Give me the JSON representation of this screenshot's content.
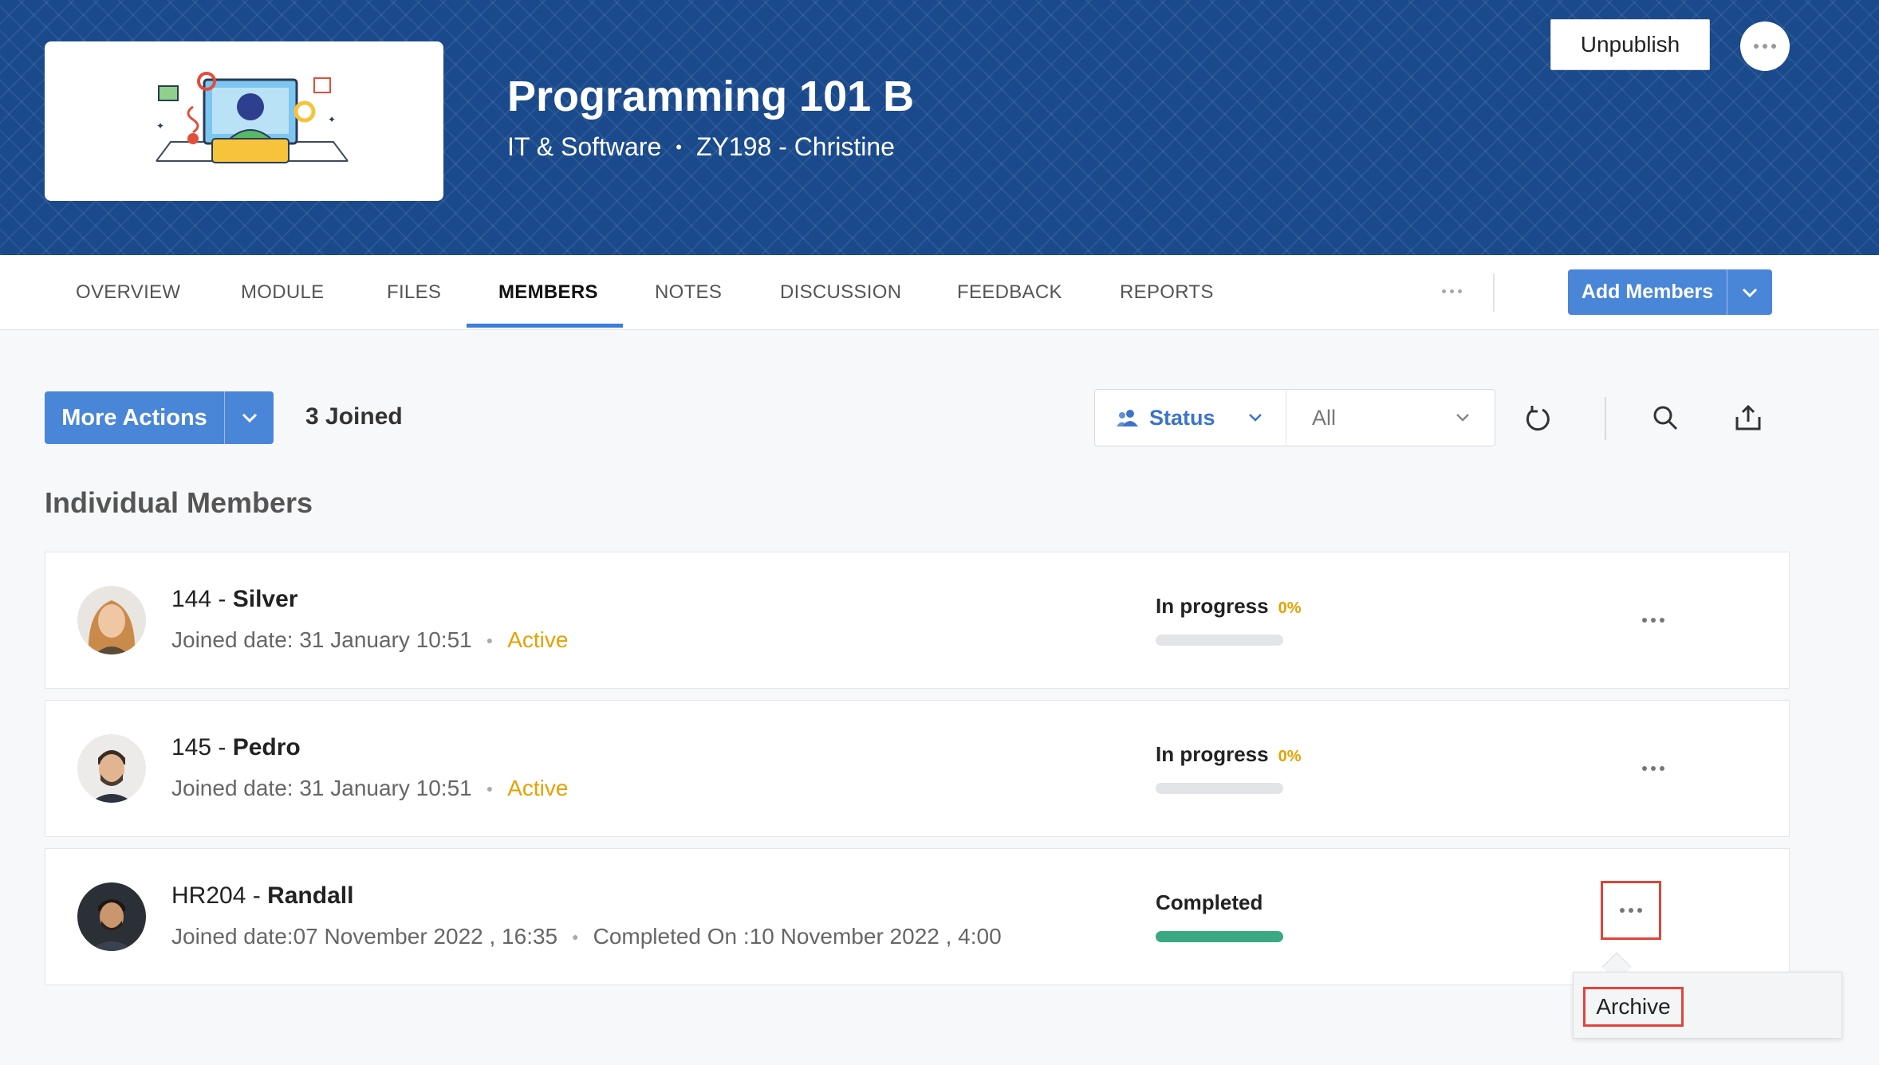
{
  "course": {
    "title": "Programming 101 B",
    "category": "IT & Software",
    "code_owner": "ZY198 - Christine"
  },
  "header": {
    "unpublish_label": "Unpublish"
  },
  "tabs": [
    {
      "label": "OVERVIEW",
      "active": false
    },
    {
      "label": "MODULE",
      "active": false
    },
    {
      "label": "FILES",
      "active": false
    },
    {
      "label": "MEMBERS",
      "active": true
    },
    {
      "label": "NOTES",
      "active": false
    },
    {
      "label": "DISCUSSION",
      "active": false
    },
    {
      "label": "FEEDBACK",
      "active": false
    },
    {
      "label": "REPORTS",
      "active": false
    }
  ],
  "add_members_label": "Add Members",
  "toolbar": {
    "more_actions_label": "More Actions",
    "joined_count": "3 Joined",
    "filter_label": "Status",
    "filter_value": "All"
  },
  "section_title": "Individual Members",
  "members": [
    {
      "id": "144",
      "name": "Silver",
      "joined": "Joined date: 31 January 10:51",
      "state": "Active",
      "completed_on": "",
      "progress_status": "In progress",
      "progress_pct": "0%",
      "progress_fraction": 0
    },
    {
      "id": "145",
      "name": "Pedro",
      "joined": "Joined date: 31 January 10:51",
      "state": "Active",
      "completed_on": "",
      "progress_status": "In progress",
      "progress_pct": "0%",
      "progress_fraction": 0
    },
    {
      "id": "HR204",
      "name": "Randall",
      "joined": "Joined date:07 November 2022 , 16:35",
      "state": "",
      "completed_on": "Completed On :10 November 2022 , 4:00",
      "progress_status": "Completed",
      "progress_pct": "",
      "progress_fraction": 1
    }
  ],
  "context_menu": {
    "archive_label": "Archive"
  },
  "colors": {
    "banner": "#1a4a8c",
    "primary_button": "#4a86d8",
    "active_text": "#e6a100",
    "progress_complete": "#3aa882",
    "highlight": "#e0443a"
  }
}
